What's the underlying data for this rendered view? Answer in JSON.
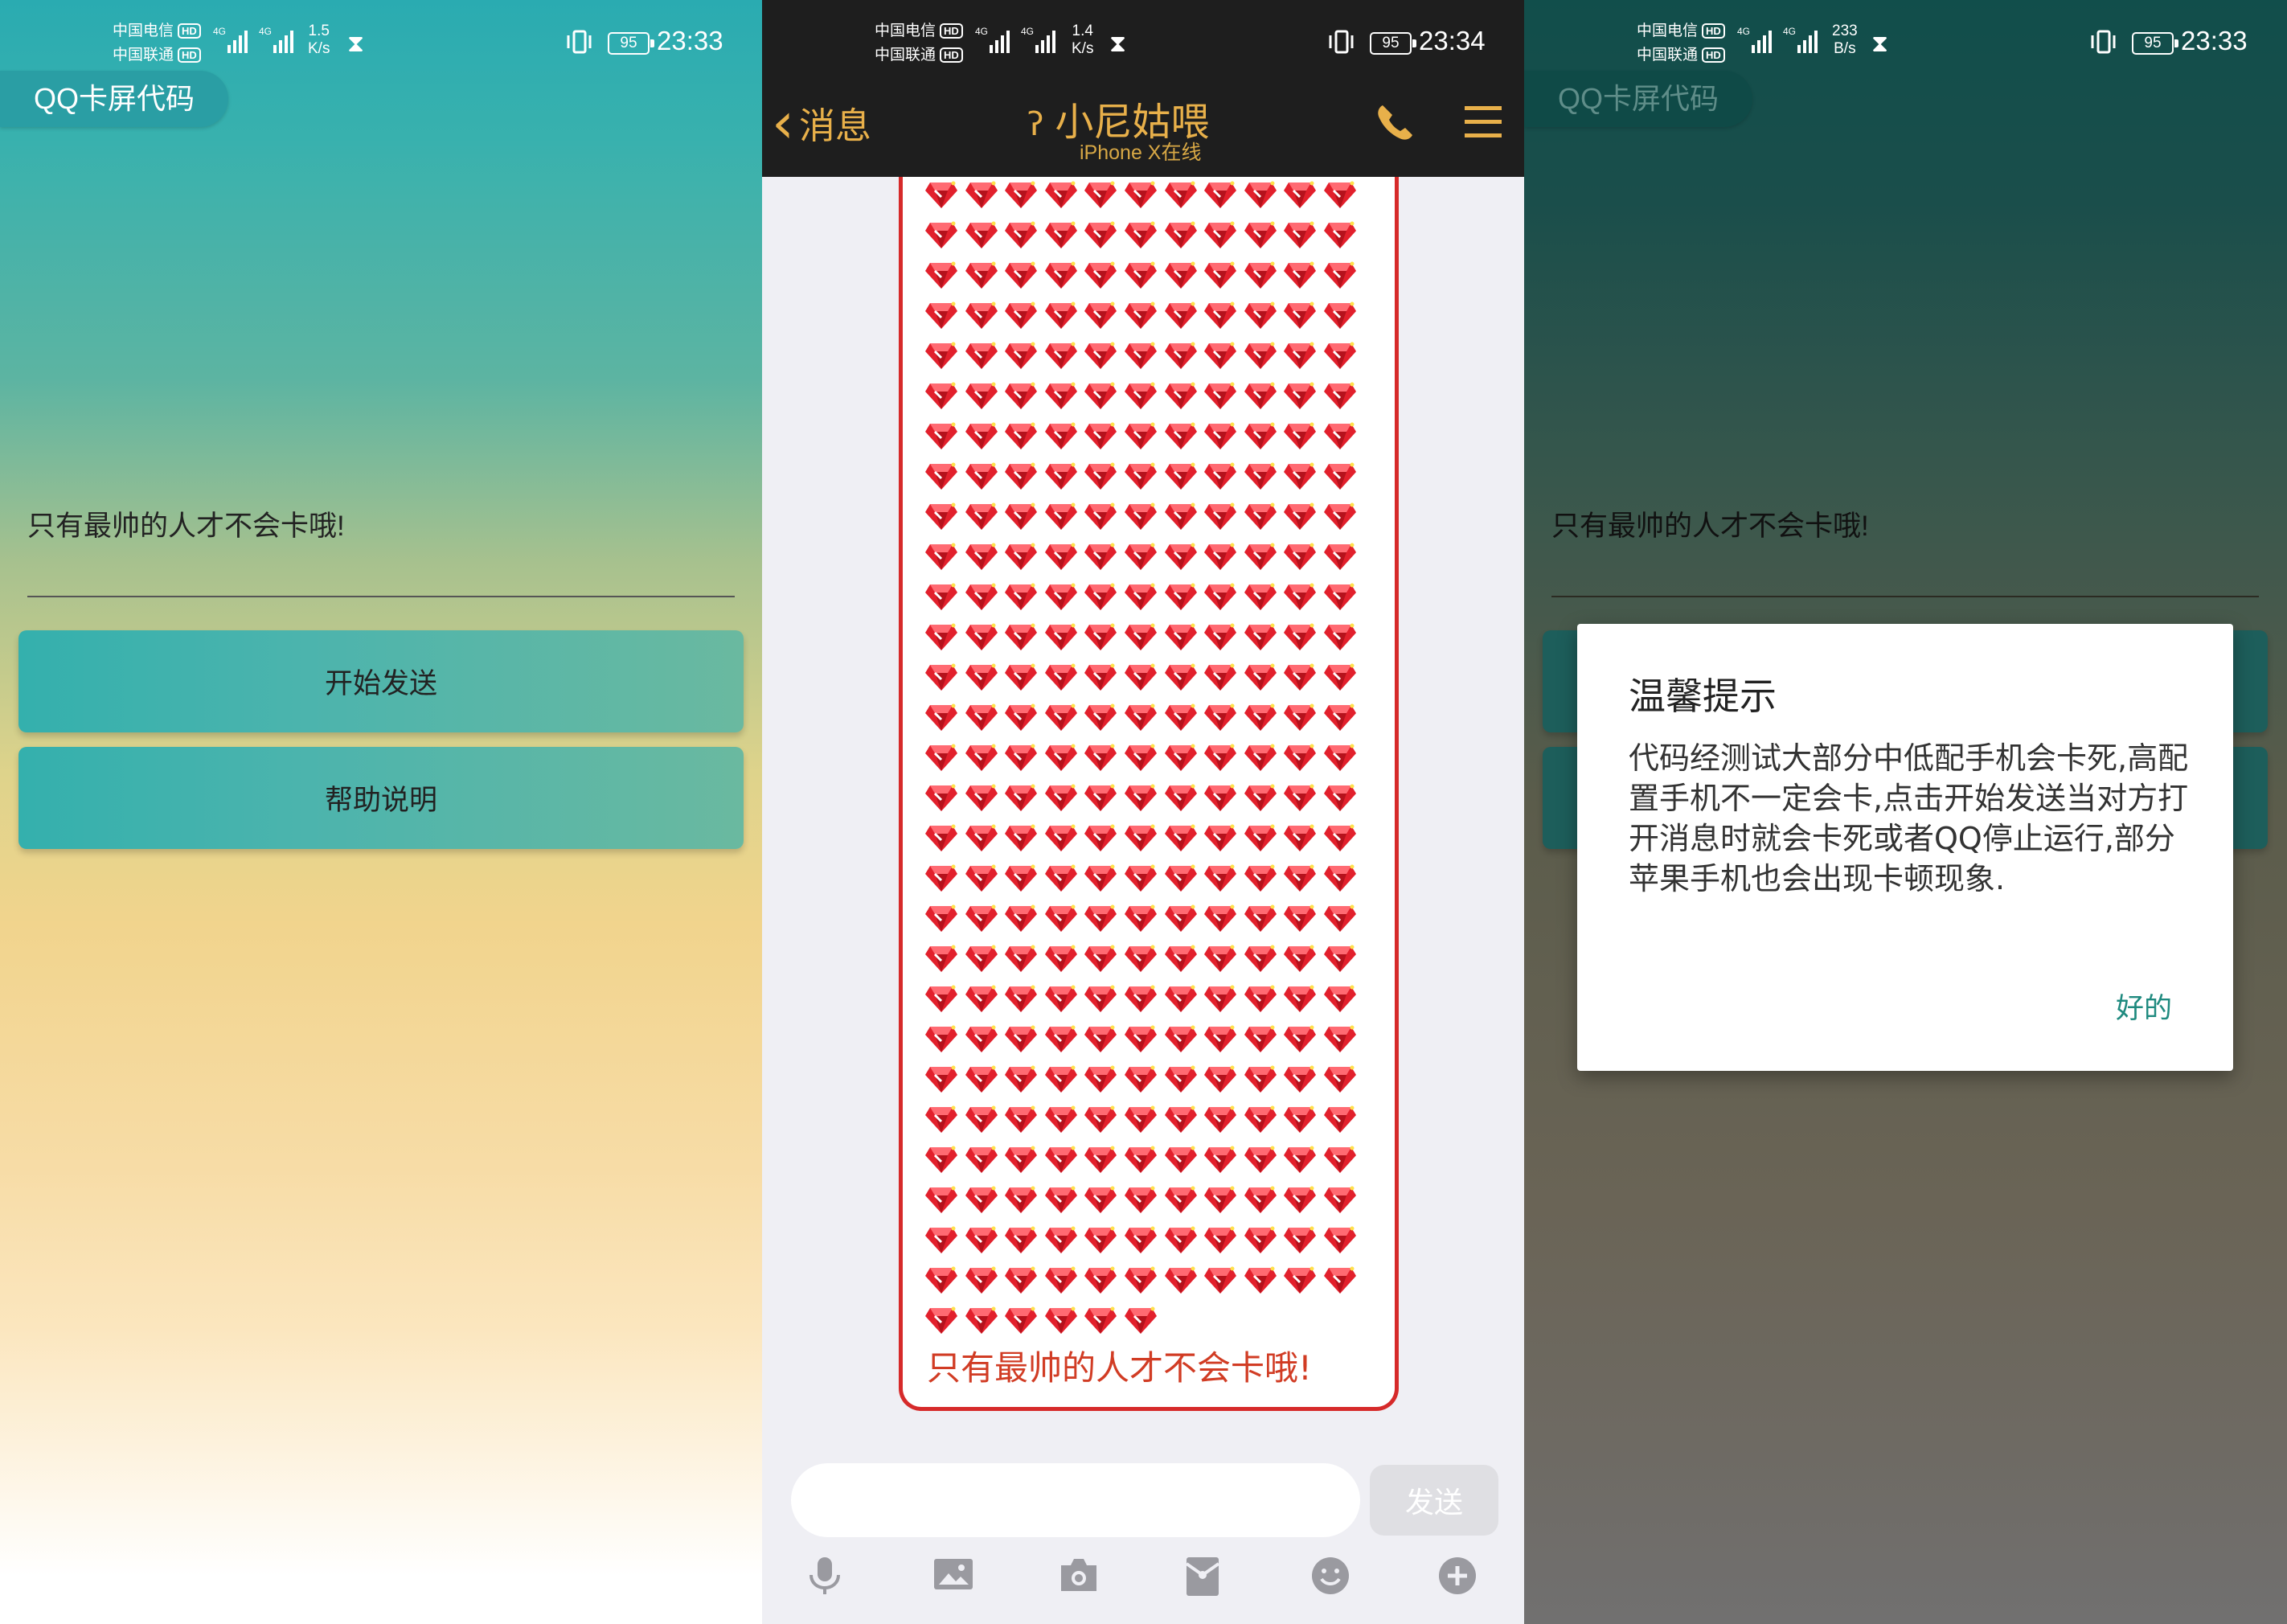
{
  "left": {
    "status": {
      "carrier1": "中国电信",
      "carrier2": "中国联通",
      "hd": "HD",
      "net_tag": "4G",
      "speed_value": "1.5",
      "speed_unit": "K/s",
      "battery": "95",
      "time": "23:33"
    },
    "app_title": "QQ卡屏代码",
    "message_text": "只有最帅的人才不会卡哦!",
    "start_button": "开始发送",
    "help_button": "帮助说明"
  },
  "middle": {
    "status": {
      "carrier1": "中国电信",
      "carrier2": "中国联通",
      "hd": "HD",
      "net_tag": "4G",
      "speed_value": "1.4",
      "speed_unit": "K/s",
      "battery": "95",
      "time": "23:34"
    },
    "back_label": "消息",
    "contact_name": "小尼姑喂",
    "contact_status": "iPhone X在线",
    "bubble_text": "只有最帅的人才不会卡哦!",
    "gem_rows": 28,
    "gem_cols": 11,
    "gem_tail_count": 6,
    "send_button": "发送",
    "toolbar_icons": [
      "microphone-icon",
      "image-icon",
      "camera-icon",
      "red-packet-icon",
      "emoji-icon",
      "plus-icon"
    ]
  },
  "right": {
    "status": {
      "carrier1": "中国电信",
      "carrier2": "中国联通",
      "hd": "HD",
      "net_tag": "4G",
      "speed_value": "233",
      "speed_unit": "B/s",
      "battery": "95",
      "time": "23:33"
    },
    "app_title": "QQ卡屏代码",
    "message_text": "只有最帅的人才不会卡哦!",
    "dialog": {
      "title": "温馨提示",
      "message": "代码经测试大部分中低配手机会卡死,高配置手机不一定会卡,点击开始发送当对方打开消息时就会卡死或者QQ停止运行,部分苹果手机也会出现卡顿现象.",
      "ok_button": "好的"
    }
  },
  "colors": {
    "accent_gold": "#e8b04a",
    "bubble_red": "#d62a2a",
    "dialog_button": "#1f8a7f",
    "teal": "#33b0ae"
  }
}
